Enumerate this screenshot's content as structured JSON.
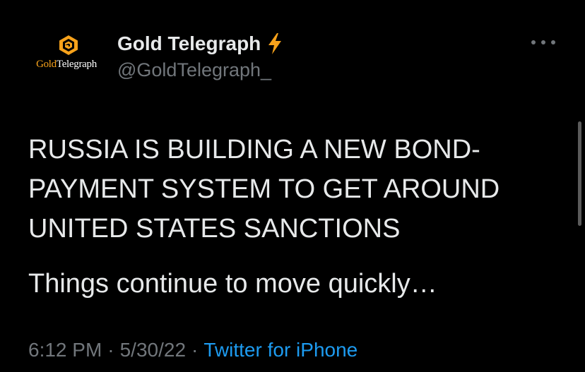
{
  "tweet": {
    "author": {
      "display_name": "Gold Telegraph",
      "handle": "@GoldTelegraph_",
      "verified_icon": "lightning-bolt-icon",
      "avatar": {
        "logo_text_gold": "Gold",
        "logo_text_rest": "Telegraph",
        "icon": "gold-telegraph-logo-icon"
      }
    },
    "more_icon": "more-options-icon",
    "headline_lines": [
      "RUSSIA IS BUILDING A NEW BOND-",
      "PAYMENT SYSTEM TO GET AROUND",
      "UNITED STATES SANCTIONS"
    ],
    "body": "Things continue to move quickly…",
    "time": "6:12 PM",
    "date": "5/30/22",
    "separator": "·",
    "source": "Twitter for iPhone"
  },
  "colors": {
    "background": "#000000",
    "text_primary": "#e7e9ea",
    "text_secondary": "#71767b",
    "link": "#1d9bf0",
    "accent_gold": "#f7a21b"
  }
}
